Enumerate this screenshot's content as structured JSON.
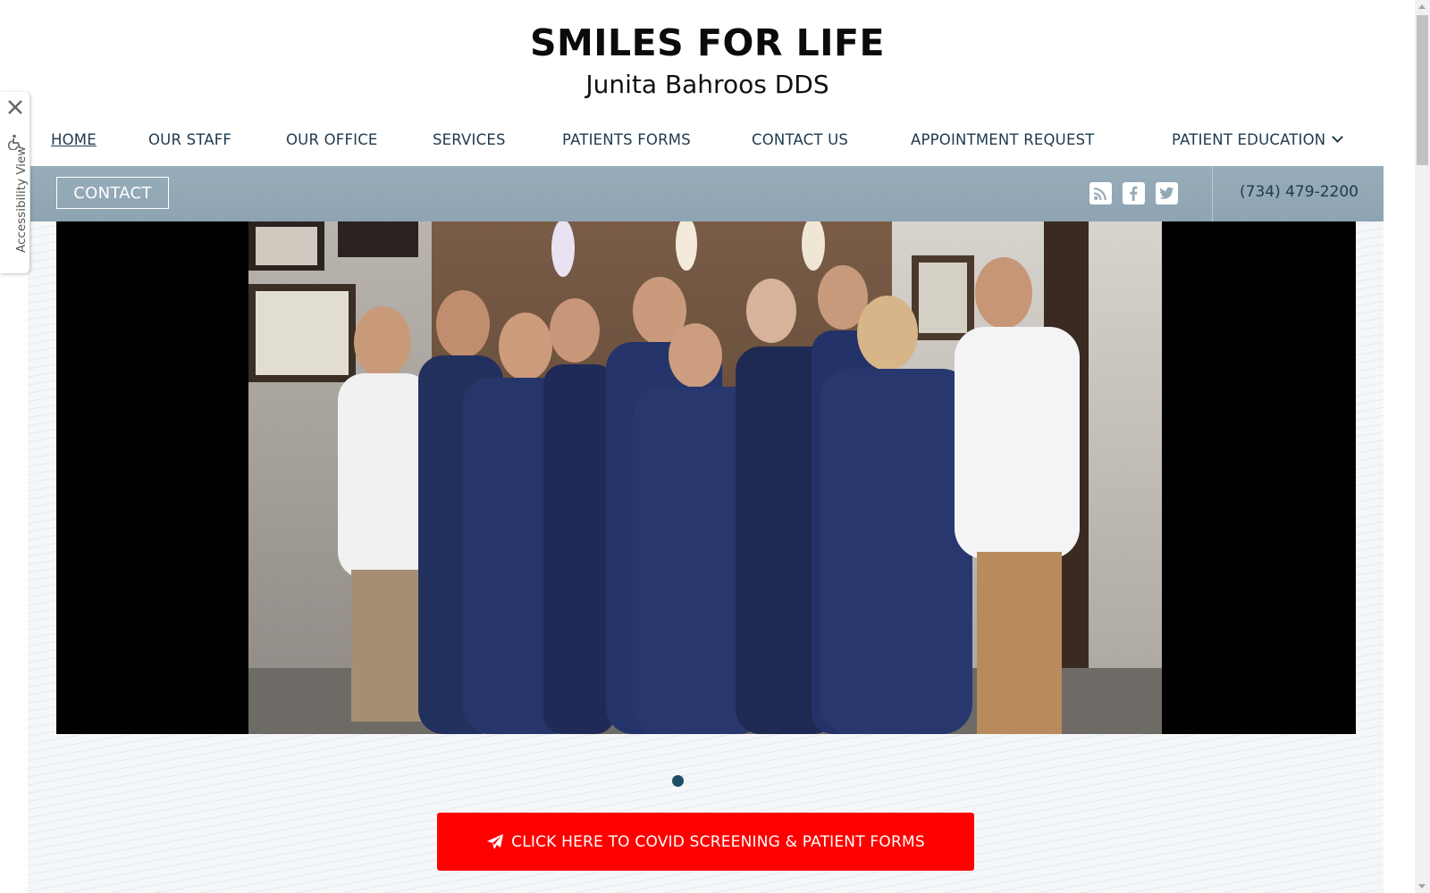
{
  "header": {
    "title": "SMILES FOR LIFE",
    "subtitle": "Junita Bahroos DDS"
  },
  "nav": {
    "items": [
      {
        "label": "HOME",
        "active": true
      },
      {
        "label": "OUR STAFF"
      },
      {
        "label": "OUR OFFICE"
      },
      {
        "label": "SERVICES"
      },
      {
        "label": "PATIENTS FORMS"
      },
      {
        "label": "CONTACT US"
      },
      {
        "label": "APPOINTMENT REQUEST"
      },
      {
        "label": "PATIENT EDUCATION",
        "has_dropdown": true
      }
    ]
  },
  "contact_bar": {
    "contact_label": "CONTACT",
    "social": [
      "rss-icon",
      "facebook-icon",
      "twitter-icon"
    ],
    "phone": "(734) 479-2200"
  },
  "slider": {
    "slides": 1,
    "active_slide": 1
  },
  "cta": {
    "label": "CLICK HERE TO COVID SCREENING & PATIENT FORMS",
    "icon": "paper-plane-icon",
    "color": "#ff0000"
  },
  "accessibility": {
    "label": "Accessibility View",
    "close_icon": "close-icon",
    "icon": "wheelchair-icon"
  },
  "colors": {
    "nav_text": "#1f3a4d",
    "contact_bar": "#94aab7",
    "cta": "#ff0000"
  }
}
